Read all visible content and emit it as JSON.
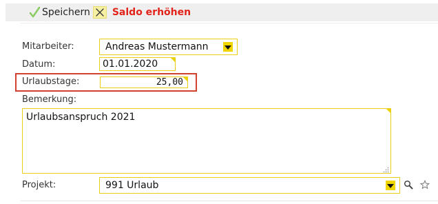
{
  "toolbar": {
    "save_label": "Speichern",
    "warning_label": "Saldo erhöhen"
  },
  "form": {
    "employee": {
      "label": "Mitarbeiter:",
      "value": "Andreas Mustermann"
    },
    "date": {
      "label": "Datum:",
      "value": "01.01.2020"
    },
    "vacation_days": {
      "label": "Urlaubstage:",
      "value": "25,00"
    },
    "remark": {
      "label": "Bemerkung:",
      "value": "Urlaubsanspruch 2021"
    },
    "project": {
      "label": "Projekt:",
      "value": "991 Urlaub"
    }
  },
  "colors": {
    "field_border": "#e8cf16",
    "highlight_border": "#d2412e",
    "warning_text": "#e2231a"
  },
  "icons": [
    "checkmark-icon",
    "close-icon",
    "search-icon",
    "star-icon",
    "dropdown-arrow-icon",
    "resize-grip-icon"
  ]
}
